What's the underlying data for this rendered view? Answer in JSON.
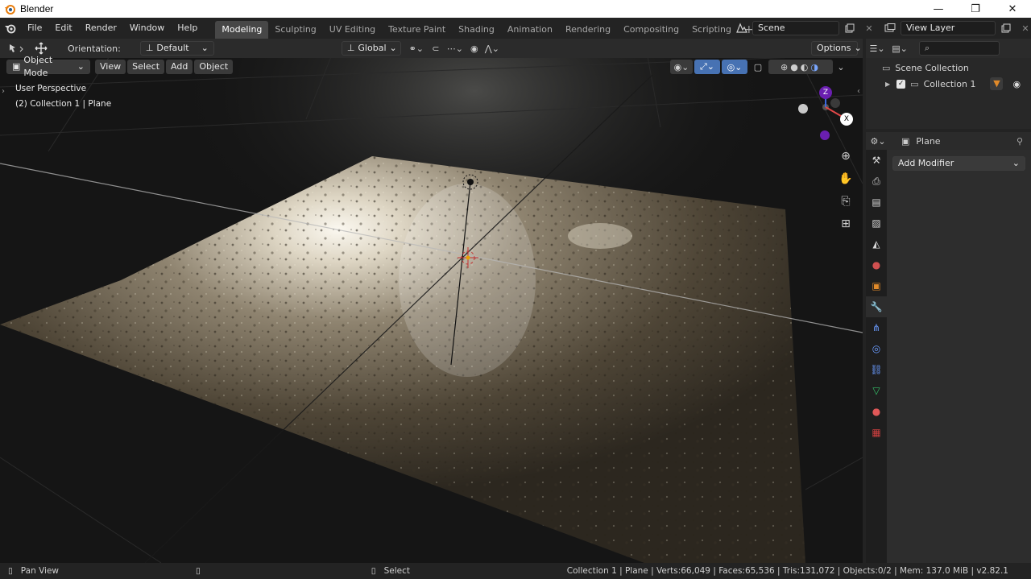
{
  "window": {
    "title": "Blender",
    "minimize": "—",
    "maximize": "❐",
    "close": "✕"
  },
  "menu": [
    "File",
    "Edit",
    "Render",
    "Window",
    "Help"
  ],
  "workspaces": [
    "Modeling",
    "Sculpting",
    "UV Editing",
    "Texture Paint",
    "Shading",
    "Animation",
    "Rendering",
    "Compositing",
    "Scripting"
  ],
  "add_workspace": "+",
  "scene": {
    "label": "Scene"
  },
  "view_layer": {
    "label": "View Layer"
  },
  "tool_header": {
    "orientation_label": "Orientation:",
    "orientation_value": "Default",
    "transform_space": "Global",
    "options": "Options"
  },
  "viewport_header": {
    "mode": "Object Mode",
    "menus": [
      "View",
      "Select",
      "Add",
      "Object"
    ]
  },
  "viewport_overlay": {
    "perspective": "User Perspective",
    "collection": "(2) Collection 1 | Plane"
  },
  "gizmo": {
    "z": "Z",
    "x": "X"
  },
  "outliner": {
    "search_placeholder": "",
    "scene_collection": "Scene Collection",
    "collection": "Collection 1"
  },
  "properties": {
    "object_name": "Plane",
    "add_modifier": "Add Modifier"
  },
  "statusbar": {
    "left_action": "Pan View",
    "mid_action": "Select",
    "stats": "Collection 1 | Plane | Verts:66,049 | Faces:65,536 | Tris:131,072 | Objects:0/2 | Mem: 137.0 MiB | v2.82.1"
  },
  "colors": {
    "accent": "#4772b3",
    "active_tab": "#474747",
    "wrench_active": "#4b6fa8",
    "terrain_light": "#cfc8b8",
    "terrain_dark": "#4a4236"
  }
}
